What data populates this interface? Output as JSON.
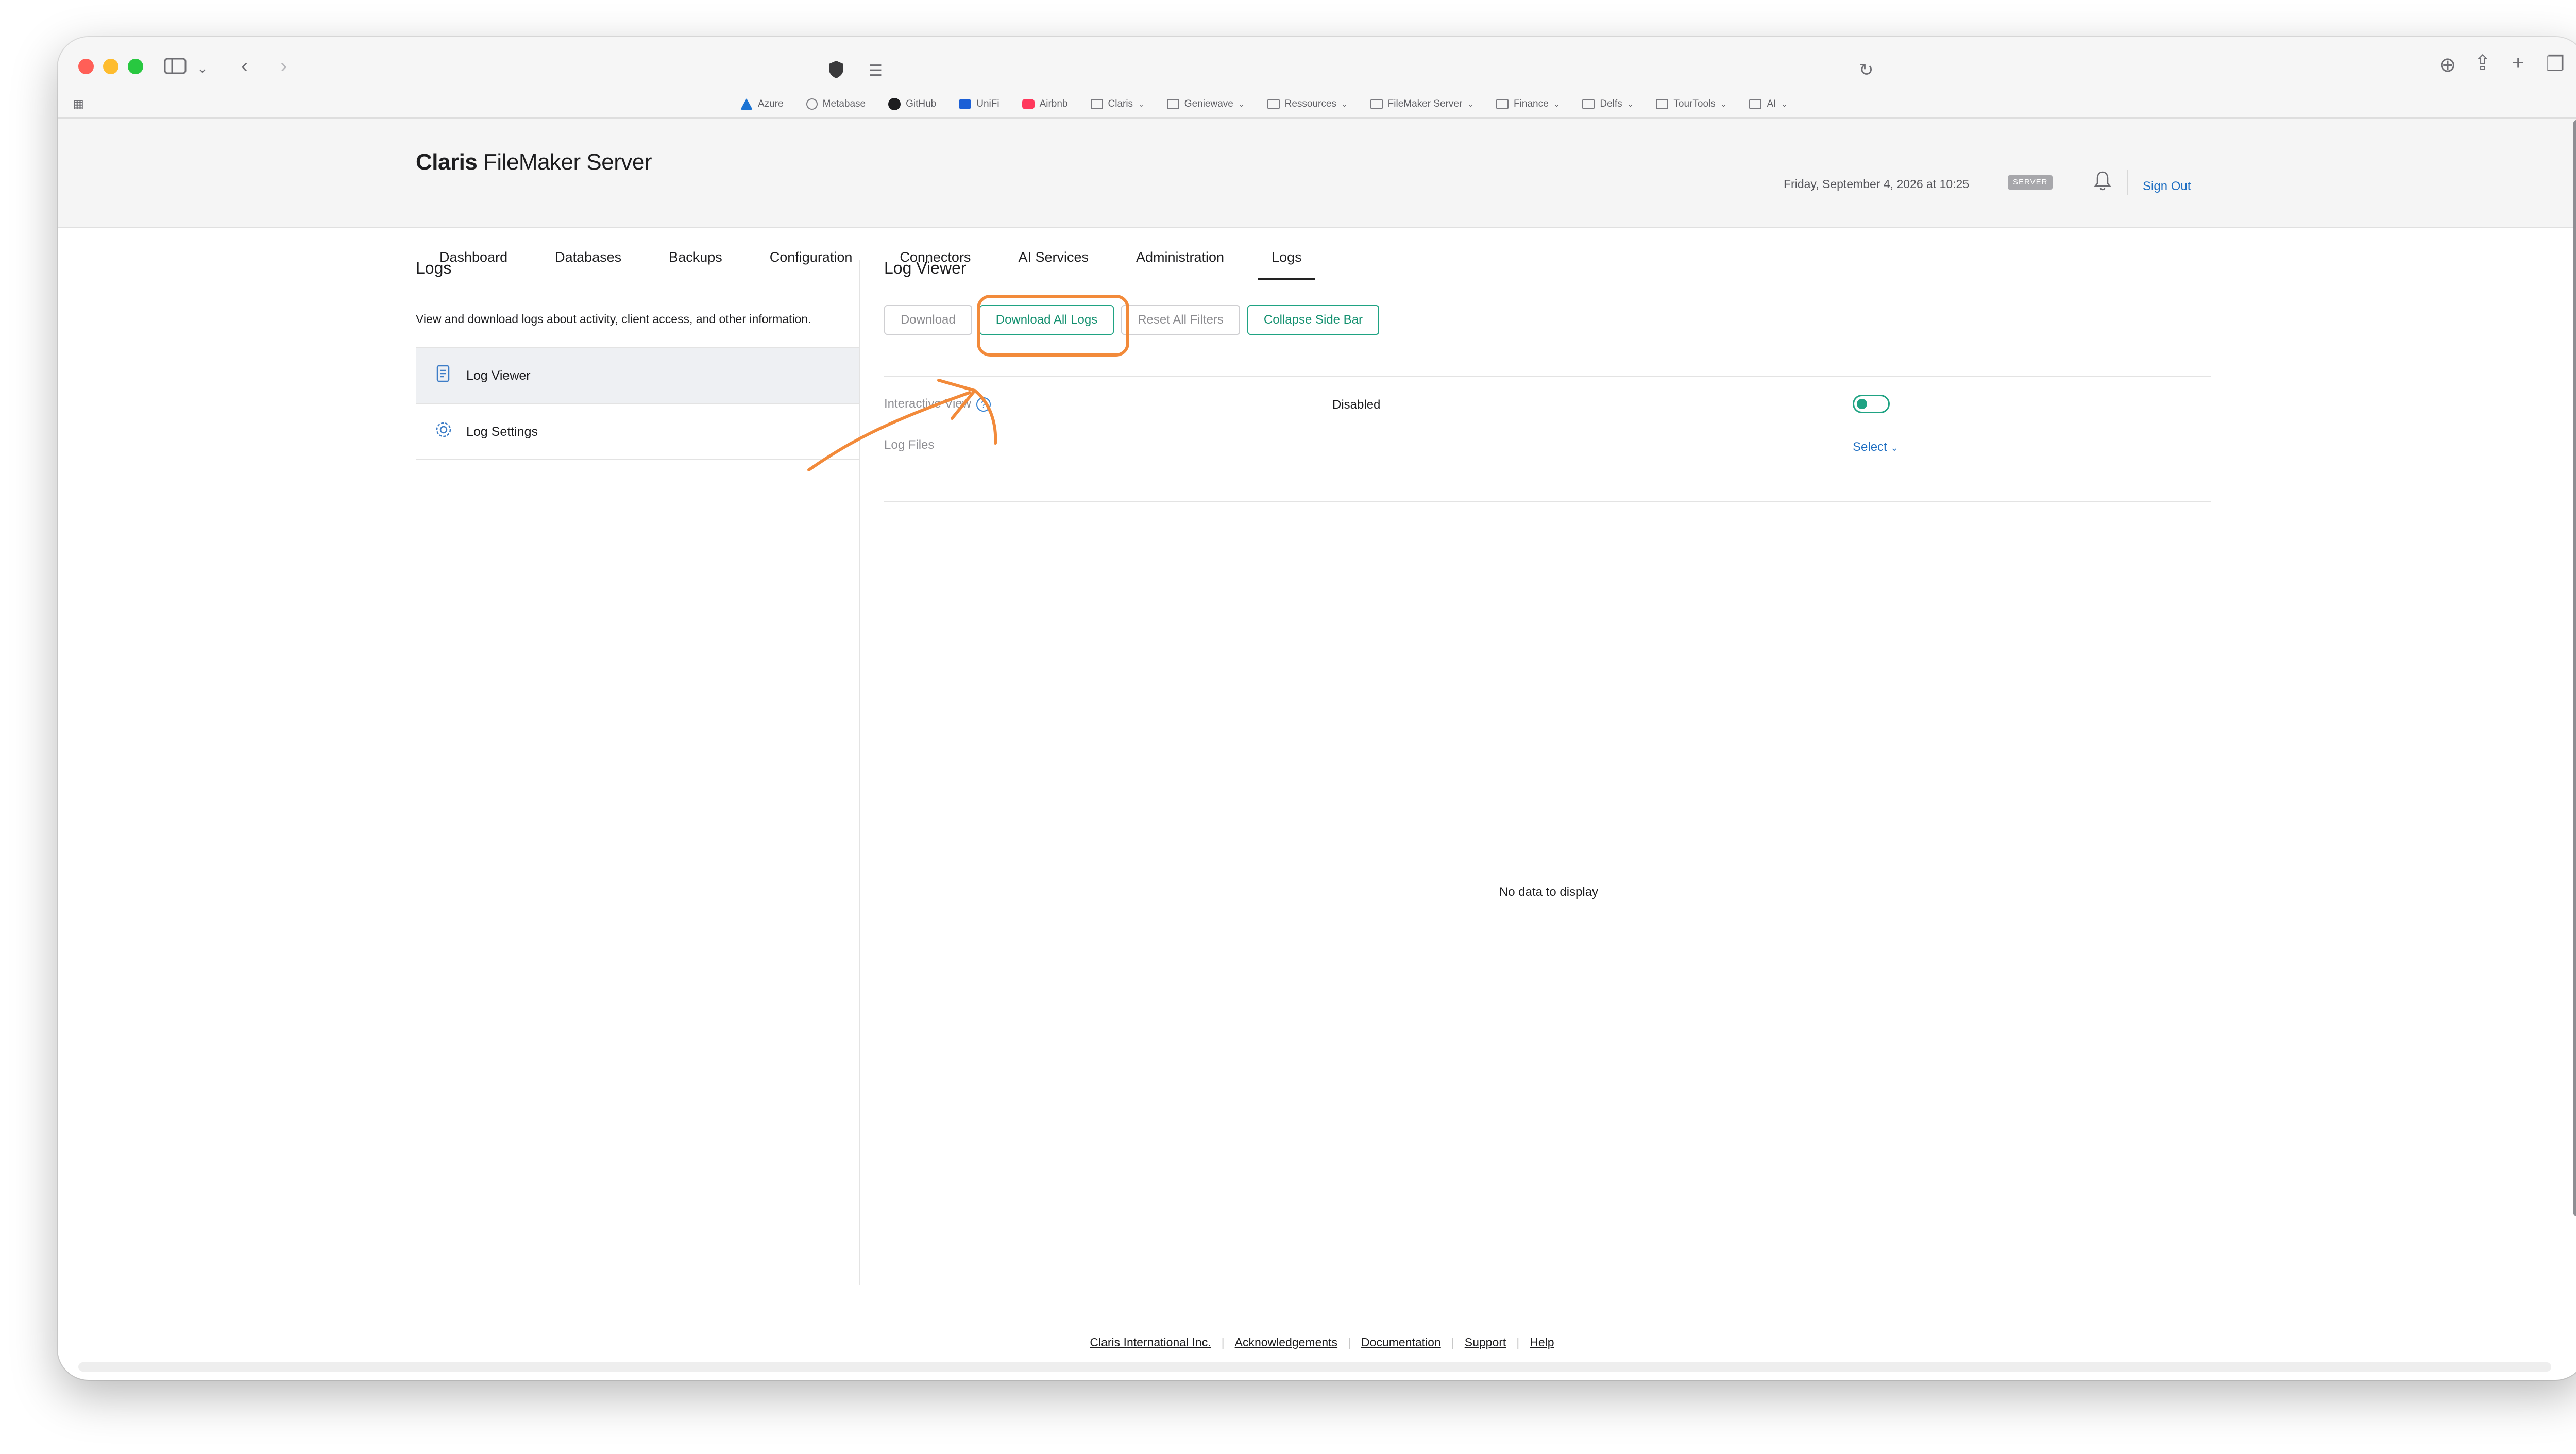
{
  "browser": {
    "bookmarks": [
      {
        "label": "Azure",
        "icon": "azure-icon"
      },
      {
        "label": "Metabase",
        "icon": "globe-icon"
      },
      {
        "label": "GitHub",
        "icon": "github-icon"
      },
      {
        "label": "UniFi",
        "icon": "unifi-icon"
      },
      {
        "label": "Airbnb",
        "icon": "airbnb-icon"
      },
      {
        "label": "Claris",
        "icon": "folder-icon",
        "folder": true
      },
      {
        "label": "Geniewave",
        "icon": "folder-icon",
        "folder": true
      },
      {
        "label": "Ressources",
        "icon": "folder-icon",
        "folder": true
      },
      {
        "label": "FileMaker Server",
        "icon": "folder-icon",
        "folder": true
      },
      {
        "label": "Finance",
        "icon": "folder-icon",
        "folder": true
      },
      {
        "label": "Delfs",
        "icon": "folder-icon",
        "folder": true
      },
      {
        "label": "TourTools",
        "icon": "folder-icon",
        "folder": true
      },
      {
        "label": "AI",
        "icon": "folder-icon",
        "folder": true
      }
    ]
  },
  "header": {
    "logo_bold": "Claris",
    "logo_rest": " FileMaker Server",
    "date": "Friday, September 4, 2026 at 10:25",
    "server_badge": "SERVER",
    "sign_out": "Sign Out"
  },
  "nav": {
    "tabs": [
      {
        "label": "Dashboard",
        "active": false
      },
      {
        "label": "Databases",
        "active": false
      },
      {
        "label": "Backups",
        "active": false
      },
      {
        "label": "Configuration",
        "active": false
      },
      {
        "label": "Connectors",
        "active": false
      },
      {
        "label": "AI Services",
        "active": false
      },
      {
        "label": "Administration",
        "active": false
      },
      {
        "label": "Logs",
        "active": true
      }
    ]
  },
  "sidebar": {
    "title": "Logs",
    "description": "View and download logs about activity, client access, and other information.",
    "items": [
      {
        "label": "Log Viewer",
        "icon": "document-icon",
        "active": true
      },
      {
        "label": "Log Settings",
        "icon": "gear-icon",
        "active": false
      }
    ]
  },
  "main": {
    "title": "Log Viewer",
    "buttons": {
      "download": "Download",
      "download_all": "Download All Logs",
      "reset_filters": "Reset All Filters",
      "collapse_sidebar": "Collapse Side Bar"
    },
    "interactive_view_label": "Interactive View",
    "interactive_view_value": "Disabled",
    "log_files_label": "Log Files",
    "select_label": "Select",
    "empty_message": "No data to display"
  },
  "footer": {
    "links": [
      "Claris International Inc.",
      "Acknowledgements",
      "Documentation",
      "Support",
      "Help"
    ]
  },
  "colors": {
    "accent_green": "#1fa383",
    "link_blue": "#1f6fc2",
    "annotation_orange": "#f28a3a"
  }
}
